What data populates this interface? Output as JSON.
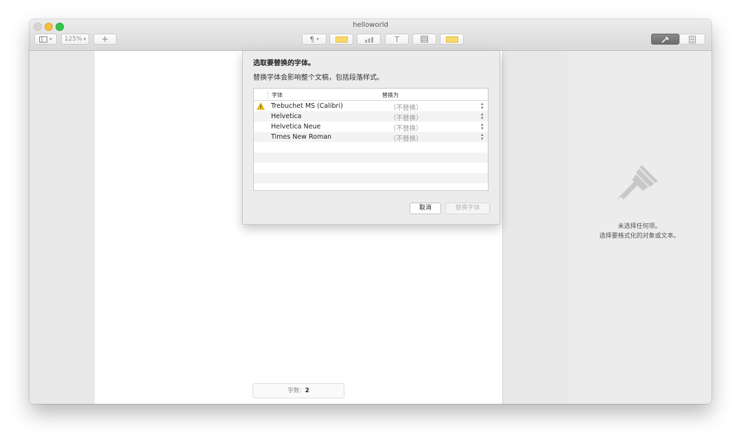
{
  "window": {
    "title": "helloworld"
  },
  "toolbar": {
    "view_icon": "sidebar-icon",
    "zoom": "125%",
    "add_label": "+",
    "paragraph_label": "¶",
    "chevron": "⌄",
    "text_label": "T",
    "accent_color": "#f8da6a"
  },
  "dialog": {
    "title": "选取要替换的字体。",
    "description": "替换字体会影响整个文稿，包括段落样式。",
    "columns": {
      "font": "字体",
      "replace_with": "替换为"
    },
    "rows": [
      {
        "font": "Trebuchet MS (Calibri)",
        "replacement": "（不替换）",
        "warning": true
      },
      {
        "font": "Helvetica",
        "replacement": "（不替换）",
        "warning": false
      },
      {
        "font": "Helvetica Neue",
        "replacement": "（不替换）",
        "warning": false
      },
      {
        "font": "Times New Roman",
        "replacement": "（不替换）",
        "warning": false
      }
    ],
    "cancel_label": "取消",
    "replace_label": "替换字体"
  },
  "status": {
    "wordcount_label": "字数：",
    "wordcount_value": "2"
  },
  "inspector": {
    "icon": "paintbrush-icon",
    "line1": "未选择任何项。",
    "line2": "选择要格式化的对象或文本。"
  }
}
